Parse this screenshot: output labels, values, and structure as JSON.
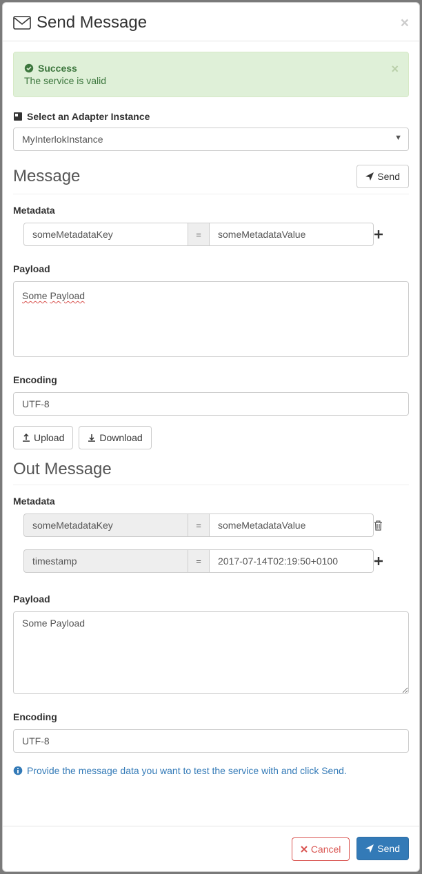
{
  "modal": {
    "title": "Send Message",
    "close": "×"
  },
  "alert": {
    "title": "Success",
    "message": "The service is valid",
    "close": "×"
  },
  "adapter": {
    "label": "Select an Adapter Instance",
    "selected": "MyInterlokInstance"
  },
  "message": {
    "title": "Message",
    "send_label": "Send",
    "metadata_label": "Metadata",
    "metadata": [
      {
        "key": "someMetadataKey",
        "value": "someMetadataValue"
      }
    ],
    "payload_label": "Payload",
    "payload_value": "Some Payload",
    "encoding_label": "Encoding",
    "encoding_value": "UTF-8",
    "upload_label": "Upload",
    "download_label": "Download"
  },
  "out_message": {
    "title": "Out Message",
    "metadata_label": "Metadata",
    "metadata": [
      {
        "key": "someMetadataKey",
        "value": "someMetadataValue",
        "readonly": true,
        "action": "delete"
      },
      {
        "key": "timestamp",
        "value": "2017-07-14T02:19:50+0100",
        "readonly": true,
        "action": "add"
      }
    ],
    "payload_label": "Payload",
    "payload_value": "Some Payload",
    "encoding_label": "Encoding",
    "encoding_value": "UTF-8"
  },
  "info_text": "Provide the message data you want to test the service with and click Send.",
  "footer": {
    "cancel_label": "Cancel",
    "send_label": "Send"
  }
}
